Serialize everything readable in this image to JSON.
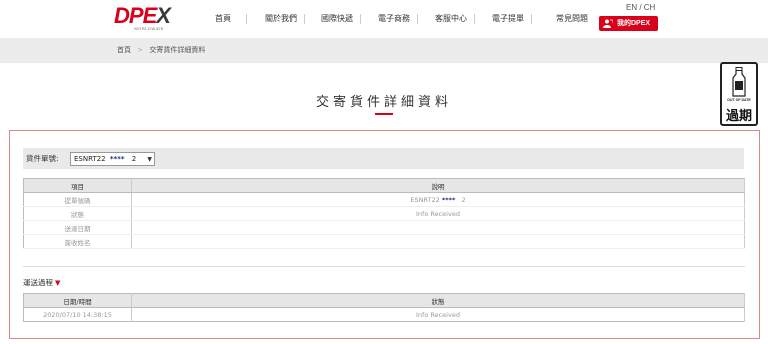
{
  "header": {
    "logo": "DPEX",
    "logo_sub": "WORLDWIDE",
    "nav": [
      "首頁",
      "關於我們",
      "國際快遞",
      "電子商務",
      "客服中心",
      "電子提單",
      "常見問題"
    ],
    "lang": "EN / CH",
    "my_button": "我的DPEX"
  },
  "breadcrumb": {
    "home": "首頁",
    "sep": ">",
    "current": "交寄貨件詳細資料"
  },
  "page_title": "交寄貨件詳細資料",
  "badge": {
    "sub": "OUT OF DATE",
    "main": "過期"
  },
  "search": {
    "label": "貨件單號:",
    "value_prefix": "ESNRT22",
    "value_mask": "****",
    "value_suffix": "2"
  },
  "detail_table": {
    "headers": [
      "項目",
      "說明"
    ],
    "rows": [
      {
        "label": "提單號碼",
        "value_prefix": "ESNRT22",
        "value_mask": "****",
        "value_suffix": "2"
      },
      {
        "label": "狀態",
        "value": "Info Received"
      },
      {
        "label": "送達日期",
        "value": ""
      },
      {
        "label": "簽收姓名",
        "value": ""
      }
    ]
  },
  "route": {
    "label": "運送過程",
    "headers": [
      "日期/時間",
      "狀態"
    ],
    "rows": [
      {
        "datetime": "2020/07/10 14:38:15",
        "status": "Info Received"
      }
    ]
  },
  "colors": {
    "brand_red": "#d9001b",
    "mask_blue": "#1a2a7a"
  }
}
